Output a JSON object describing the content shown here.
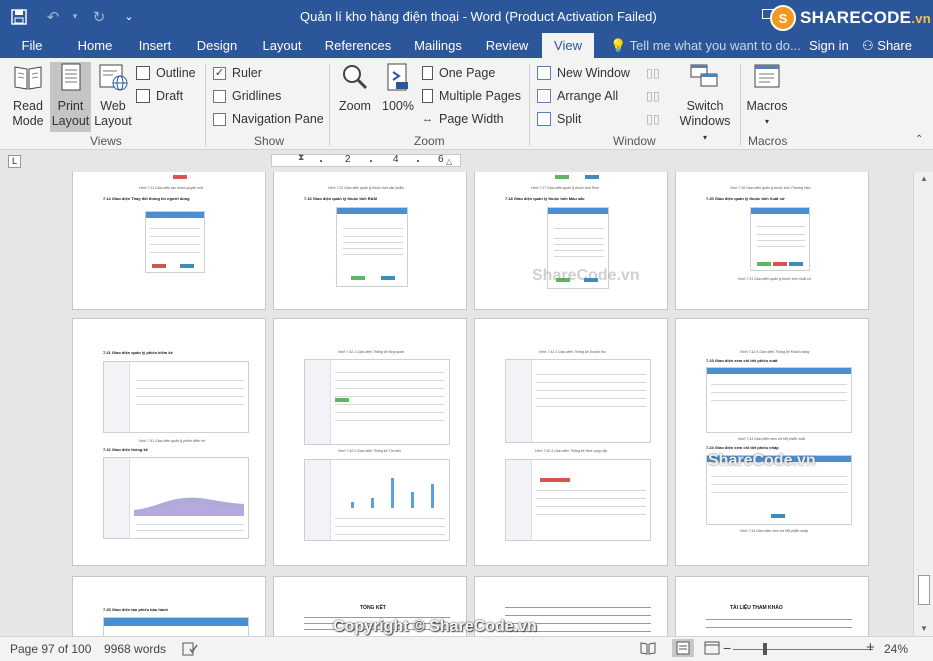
{
  "window": {
    "title": "Quản lí kho hàng điện thoại - Word (Product Activation Failed)",
    "brand": "SHARECODE",
    "brand_suffix": ".vn"
  },
  "qat": [
    {
      "icon": "save-icon",
      "glyph": "🖫"
    },
    {
      "icon": "undo-icon",
      "glyph": "↶"
    },
    {
      "icon": "undo-dropdown-icon",
      "glyph": "▾"
    },
    {
      "icon": "redo-icon",
      "glyph": "↻"
    },
    {
      "icon": "customize-qat-icon",
      "glyph": "≡"
    }
  ],
  "tabs": [
    "File",
    "Home",
    "Insert",
    "Design",
    "Layout",
    "References",
    "Mailings",
    "Review",
    "View"
  ],
  "active_tab": "View",
  "tell_me": "Tell me what you want to do...",
  "signin": "Sign in",
  "share": "Share",
  "ribbon": {
    "views": {
      "group": "Views",
      "read_mode": [
        "Read",
        "Mode"
      ],
      "print_layout": [
        "Print",
        "Layout"
      ],
      "web_layout": [
        "Web",
        "Layout"
      ],
      "outline": "Outline",
      "draft": "Draft"
    },
    "show": {
      "group": "Show",
      "ruler": {
        "label": "Ruler",
        "checked": true
      },
      "gridlines": {
        "label": "Gridlines",
        "checked": false
      },
      "navigation_pane": {
        "label": "Navigation Pane",
        "checked": false
      }
    },
    "zoom": {
      "group": "Zoom",
      "zoom": "Zoom",
      "hundred": "100%",
      "one_page": "One Page",
      "multiple_pages": "Multiple Pages",
      "page_width": "Page Width"
    },
    "window": {
      "group": "Window",
      "new_window": "New Window",
      "arrange_all": "Arrange All",
      "split": "Split",
      "switch_windows": [
        "Switch",
        "Windows"
      ]
    },
    "macros": {
      "group": "Macros",
      "macros": "Macros"
    }
  },
  "ruler": {
    "marks": [
      "2",
      "4",
      "6"
    ],
    "tab_selector": "L"
  },
  "pages": {
    "row1": [
      {
        "cap": "Hình 7.21 Giao diện tạo nhóm quyền mới",
        "head": "7.14   Giao diện Thay đổi thông tin người dùng",
        "cap2": ""
      },
      {
        "cap": "Hình 7.22 Giao diện quản lý thuộc tính sản phẩm",
        "head": "7.16   Giao diện quản lý thuộc tính RAM",
        "cap2": ""
      },
      {
        "cap": "Hình 7.27 Giao diện quản lý thuộc tính Rom",
        "head": "7.18   Giao diện quản lý thuộc tính Màu sắc",
        "cap2": ""
      },
      {
        "cap": "Hình 7.28 Giao diện quản lý thuộc tính Thương hiệu",
        "head": "7.20   Giao diện quản lý thuộc tính Xuất xứ",
        "cap2": "Hình 7.31 Giao diện quản lý thuộc tính Xuất xứ"
      }
    ],
    "row2": [
      {
        "cap": "",
        "head": "7.21   Giao diện quản lý phiếu kiểm kê",
        "cap2": "Hình 7.41 Giao diện quản lý phiếu kiểm kê",
        "head2": "7.22   Giao diện thống kê"
      },
      {
        "cap": "Hình 7.42.1 Giao diện Thống kê tổng quan",
        "head": "",
        "cap2": "Hình 7.42.2 Giao diện Thống kê Tồn kho",
        "head2": ""
      },
      {
        "cap": "Hình 7.42.3 Giao diện Thống kê Doanh thu",
        "head": "",
        "cap2": "Hình 7.42.4 Giao diện Thống kê Nhà cung cấp",
        "head2": ""
      },
      {
        "cap": "Hình 7.42.5 Giao diện Thống kê Khách hàng",
        "head": "7.23   Giao diện xem chi tiết phiếu xuất",
        "cap2": "Hình 7.43 Giao diện xem chi tiết phiếu xuất",
        "head2": "7.24   Giao diện xem chi tiết phiếu nhập",
        "cap3": "Hình 7.44 Giao diện xem chi tiết phiếu nhập"
      }
    ],
    "row3": [
      {
        "head": "7.25   Giao diện tạo phiếu bảo hành"
      },
      {
        "title": "TỔNG KẾT"
      },
      {
        "head": ""
      },
      {
        "title": "TÀI LIỆU THAM KHẢO"
      }
    ]
  },
  "watermark": "ShareCode.vn",
  "copyright": "Copyright © ShareCode.vn",
  "status": {
    "page": "Page 97 of 100",
    "words": "9968 words",
    "zoom": "24%",
    "zoom_level": 0.24
  }
}
